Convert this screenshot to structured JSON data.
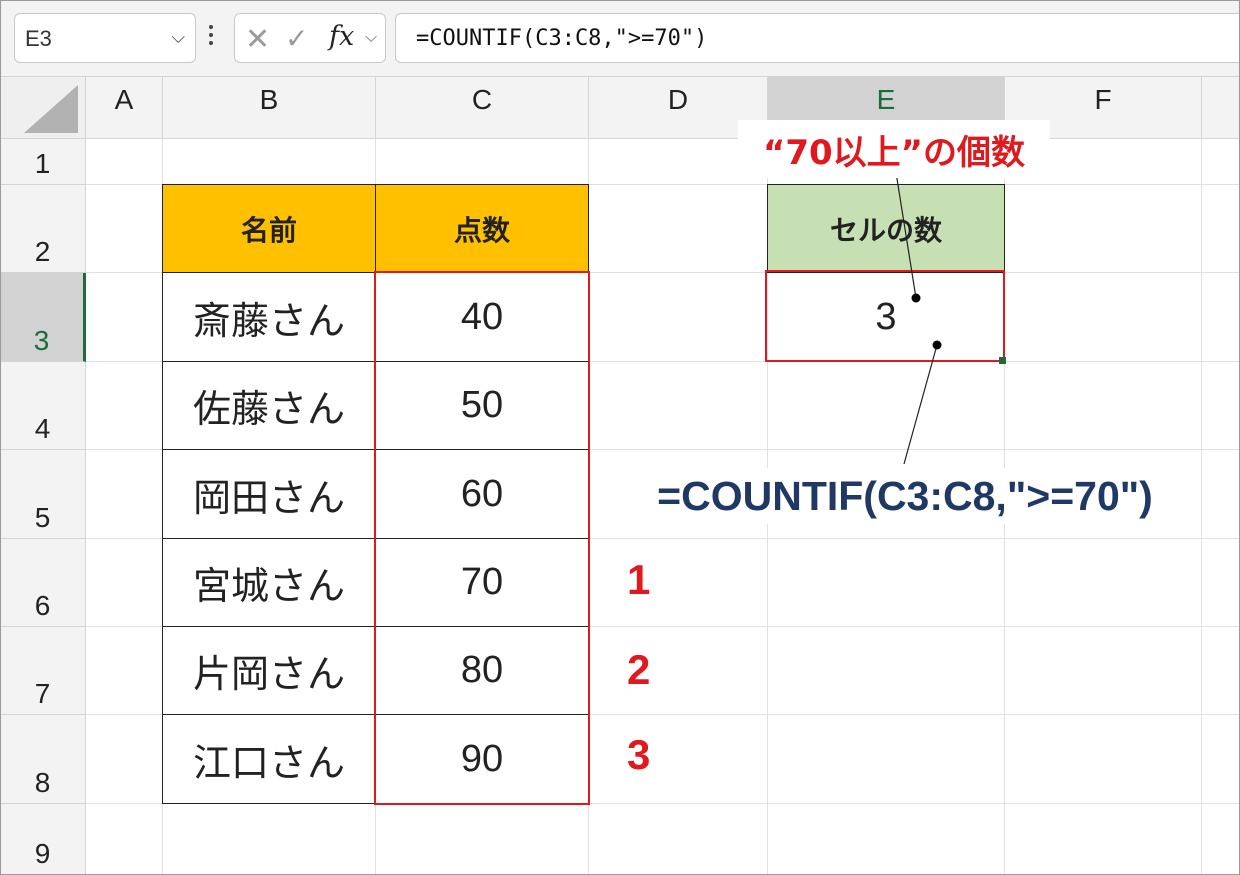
{
  "formula_bar": {
    "name_box": "E3",
    "name_box_caret": "⌵",
    "cancel_icon": "✕",
    "enter_icon": "✓",
    "fx_label": "fx",
    "fx_caret": "⌵",
    "formula": "=COUNTIF(C3:C8,\">=70\")"
  },
  "columns": [
    "A",
    "B",
    "C",
    "D",
    "E",
    "F"
  ],
  "selected_column": "E",
  "rows": [
    "1",
    "2",
    "3",
    "4",
    "5",
    "6",
    "7",
    "8",
    "9"
  ],
  "selected_row": "3",
  "table": {
    "header_name": "名前",
    "header_score": "点数",
    "rows": [
      {
        "name": "斎藤さん",
        "score": "40"
      },
      {
        "name": "佐藤さん",
        "score": "50"
      },
      {
        "name": "岡田さん",
        "score": "60"
      },
      {
        "name": "宮城さん",
        "score": "70"
      },
      {
        "name": "片岡さん",
        "score": "80"
      },
      {
        "name": "江口さん",
        "score": "90"
      }
    ]
  },
  "result": {
    "header": "セルの数",
    "value": "3"
  },
  "annotations": {
    "callout": "“70以上”の個数",
    "formula": "=COUNTIF(C3:C8,\">=70\")",
    "counts": [
      "1",
      "2",
      "3"
    ]
  },
  "colors": {
    "accent_red": "#e0191e",
    "header_orange": "#ffc000",
    "header_green": "#c6e0b4",
    "formula_navy": "#1f3864",
    "selection_green": "#1e6b3a"
  }
}
